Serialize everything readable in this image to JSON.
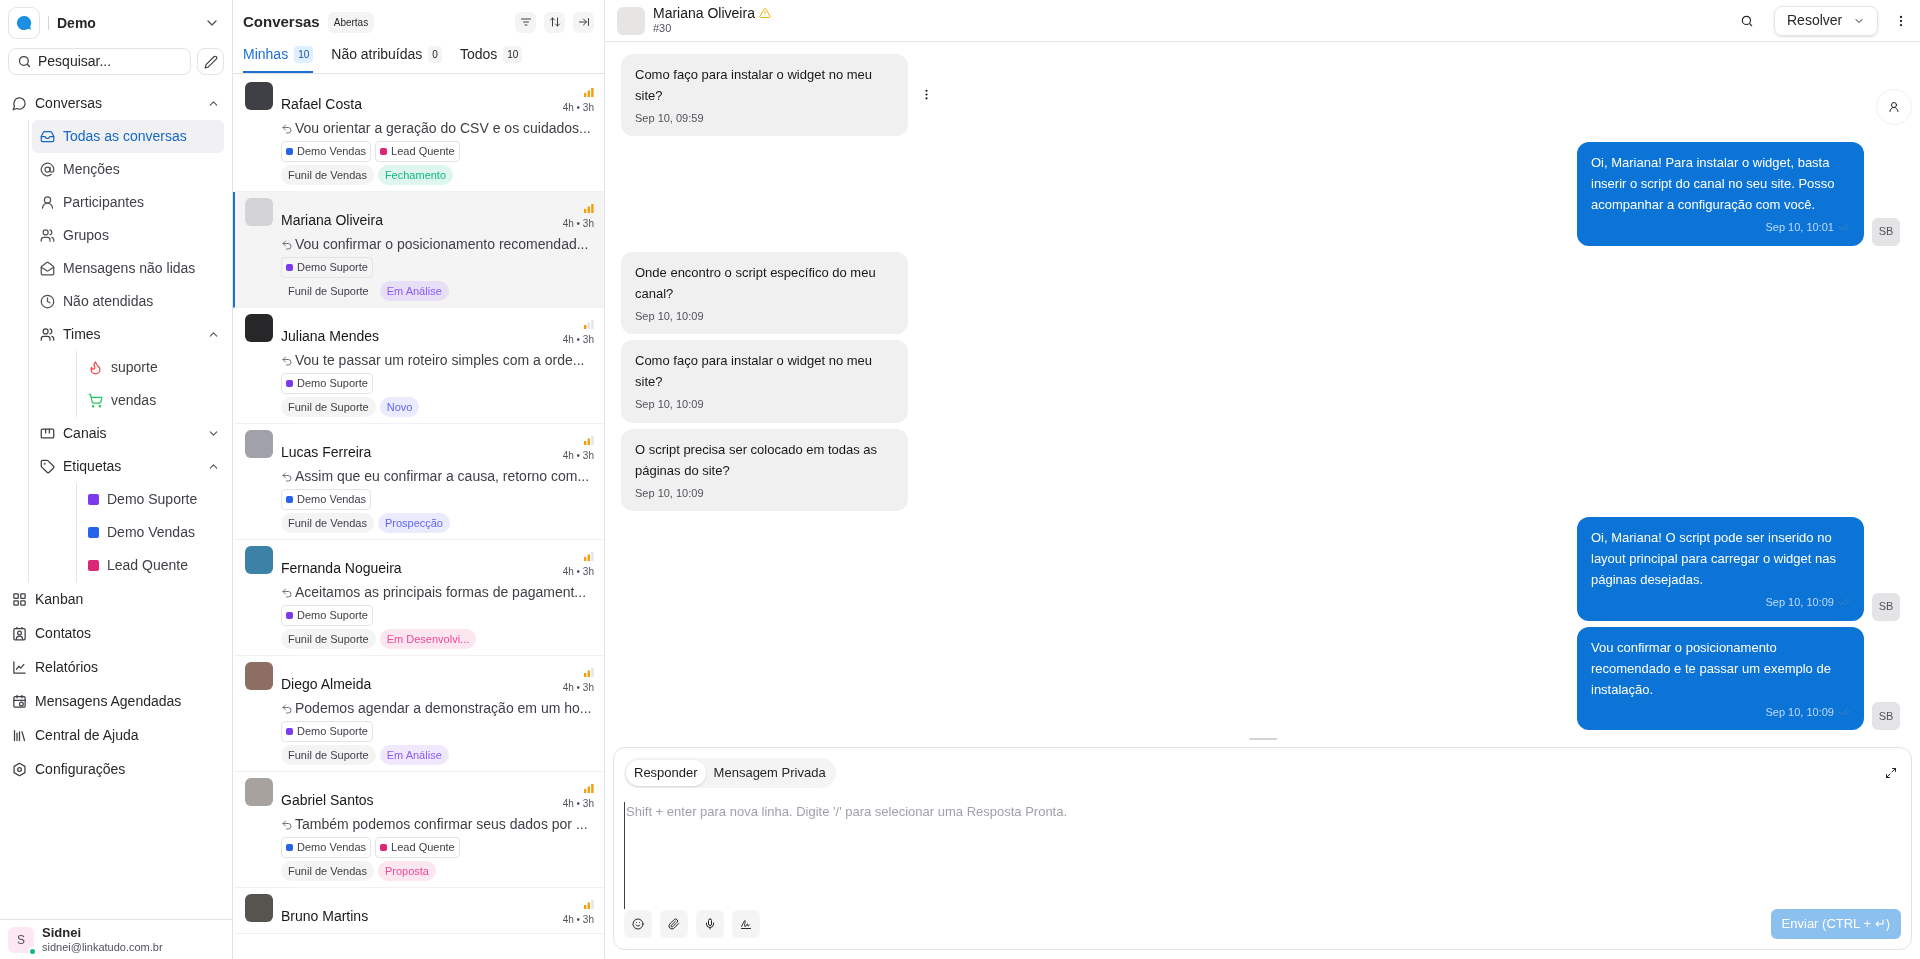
{
  "sidebar": {
    "workspace": "Demo",
    "search": {
      "placeholder": "Pesquisar..."
    },
    "conversations": {
      "label": "Conversas",
      "expanded": true,
      "items": [
        {
          "label": "Todas as conversas",
          "selected": true
        },
        {
          "label": "Menções",
          "selected": false
        },
        {
          "label": "Participantes",
          "selected": false
        },
        {
          "label": "Grupos",
          "selected": false
        },
        {
          "label": "Mensagens não lidas",
          "selected": false
        },
        {
          "label": "Não atendidas",
          "selected": false
        }
      ]
    },
    "teams": {
      "label": "Times",
      "expanded": true,
      "items": [
        {
          "label": "suporte",
          "selected": false
        },
        {
          "label": "vendas",
          "selected": false
        }
      ]
    },
    "channels": {
      "label": "Canais",
      "expanded": false
    },
    "labels": {
      "label": "Etiquetas",
      "expanded": true,
      "items": [
        {
          "label": "Demo Suporte",
          "color": "#7c3aed",
          "selected": false
        },
        {
          "label": "Demo Vendas",
          "color": "#2563eb",
          "selected": false
        },
        {
          "label": "Lead Quente",
          "color": "#db2777",
          "selected": false
        }
      ]
    },
    "links": [
      {
        "label": "Kanban",
        "selected": false
      },
      {
        "label": "Contatos",
        "selected": false
      },
      {
        "label": "Relatórios",
        "selected": false
      },
      {
        "label": "Mensagens Agendadas",
        "selected": false
      },
      {
        "label": "Central de Ajuda",
        "selected": false
      },
      {
        "label": "Configurações",
        "selected": false
      }
    ],
    "user": {
      "initial": "S",
      "name": "Sidnei",
      "email": "sidnei@linkatudo.com.br",
      "online": true
    }
  },
  "list": {
    "title": "Conversas",
    "status": "Abertas",
    "tabs": [
      {
        "label": "Minhas",
        "count": "10",
        "selected": true
      },
      {
        "label": "Não atribuídas",
        "count": "0",
        "selected": false
      },
      {
        "label": "Todos",
        "count": "10",
        "selected": false
      }
    ],
    "conversations": [
      {
        "name": "Rafael Costa",
        "time": "4h • 3h",
        "level": 1,
        "preview": "Vou orientar a geração do CSV e os cuidados...",
        "labels": [
          {
            "label": "Demo Vendas",
            "color": "#2563eb"
          },
          {
            "label": "Lead Quente",
            "color": "#db2777"
          }
        ],
        "funnel": "Funil de Vendas",
        "stage": {
          "label": "Fechamento",
          "color": "#10b981"
        },
        "selected": false
      },
      {
        "name": "Mariana Oliveira",
        "time": "4h • 3h",
        "level": 1,
        "preview": "Vou confirmar o posicionamento recomendad...",
        "labels": [
          {
            "label": "Demo Suporte",
            "color": "#7c3aed"
          }
        ],
        "funnel": "Funil de Suporte",
        "stage": {
          "label": "Em Análise",
          "color": "#8b5cf6"
        },
        "selected": true
      },
      {
        "name": "Juliana Mendes",
        "time": "4h • 3h",
        "level": 0.33,
        "preview": "Vou te passar um roteiro simples com a orde...",
        "labels": [
          {
            "label": "Demo Suporte",
            "color": "#7c3aed"
          }
        ],
        "funnel": "Funil de Suporte",
        "stage": {
          "label": "Novo",
          "color": "#6366f1"
        },
        "selected": false
      },
      {
        "name": "Lucas Ferreira",
        "time": "4h • 3h",
        "level": 0.67,
        "preview": "Assim que eu confirmar a causa, retorno com...",
        "labels": [
          {
            "label": "Demo Vendas",
            "color": "#2563eb"
          }
        ],
        "funnel": "Funil de Vendas",
        "stage": {
          "label": "Prospecção",
          "color": "#6366f1"
        },
        "selected": false
      },
      {
        "name": "Fernanda Nogueira",
        "time": "4h • 3h",
        "level": 0.67,
        "preview": "Aceitamos as principais formas de pagament...",
        "labels": [
          {
            "label": "Demo Suporte",
            "color": "#7c3aed"
          }
        ],
        "funnel": "Funil de Suporte",
        "stage": {
          "label": "Em Desenvolvi...",
          "color": "#ec4899"
        },
        "selected": false
      },
      {
        "name": "Diego Almeida",
        "time": "4h • 3h",
        "level": 0.67,
        "preview": "Podemos agendar a demonstração em um ho...",
        "labels": [
          {
            "label": "Demo Suporte",
            "color": "#7c3aed"
          }
        ],
        "funnel": "Funil de Suporte",
        "stage": {
          "label": "Em Análise",
          "color": "#8b5cf6"
        },
        "selected": false
      },
      {
        "name": "Gabriel Santos",
        "time": "4h • 3h",
        "level": 1,
        "preview": "Também podemos confirmar seus dados por ...",
        "labels": [
          {
            "label": "Demo Vendas",
            "color": "#2563eb"
          },
          {
            "label": "Lead Quente",
            "color": "#db2777"
          }
        ],
        "funnel": "Funil de Vendas",
        "stage": {
          "label": "Proposta",
          "color": "#ec4899"
        },
        "selected": false
      },
      {
        "name": "Bruno Martins",
        "time": "4h • 3h",
        "level": 0.67,
        "selected": false
      }
    ]
  },
  "chat": {
    "contact": {
      "name": "Mariana Oliveira",
      "id": "#30",
      "warning": true
    },
    "resolve_button": "Resolver",
    "messages": [
      {
        "kind": "incoming",
        "text": "Como faço para instalar o widget no meu site?",
        "time": "Sep 10, 09:59"
      },
      {
        "kind": "outgoing",
        "text": "Oi, Mariana! Para instalar o widget, basta inserir o script do canal no seu site. Posso acompanhar a configuração com você.",
        "time": "Sep 10, 10:01",
        "sender": "SB"
      },
      {
        "kind": "incoming",
        "text": "Onde encontro o script específico do meu canal?",
        "time": "Sep 10, 10:09"
      },
      {
        "kind": "incoming",
        "text": "Como faço para instalar o widget no meu site?",
        "time": "Sep 10, 10:09"
      },
      {
        "kind": "incoming",
        "text": "O script precisa ser colocado em todas as páginas do site?",
        "time": "Sep 10, 10:09"
      },
      {
        "kind": "outgoing",
        "text": "Oi, Mariana! O script pode ser inserido no layout principal para carregar o widget nas páginas desejadas.",
        "time": "Sep 10, 10:09",
        "sender": "SB"
      },
      {
        "kind": "outgoing",
        "text": "Vou confirmar o posicionamento recomendado e te passar um exemplo de instalação.",
        "time": "Sep 10, 10:09",
        "sender": "SB"
      }
    ],
    "composer": {
      "tabs": [
        {
          "label": "Responder",
          "selected": true
        },
        {
          "label": "Mensagem Privada",
          "selected": false
        }
      ],
      "placeholder": "Shift + enter para nova linha. Digite '/' para selecionar uma Resposta Pronta.",
      "send_button": "Enviar (CTRL + ↵)",
      "send_disabled": true
    }
  }
}
